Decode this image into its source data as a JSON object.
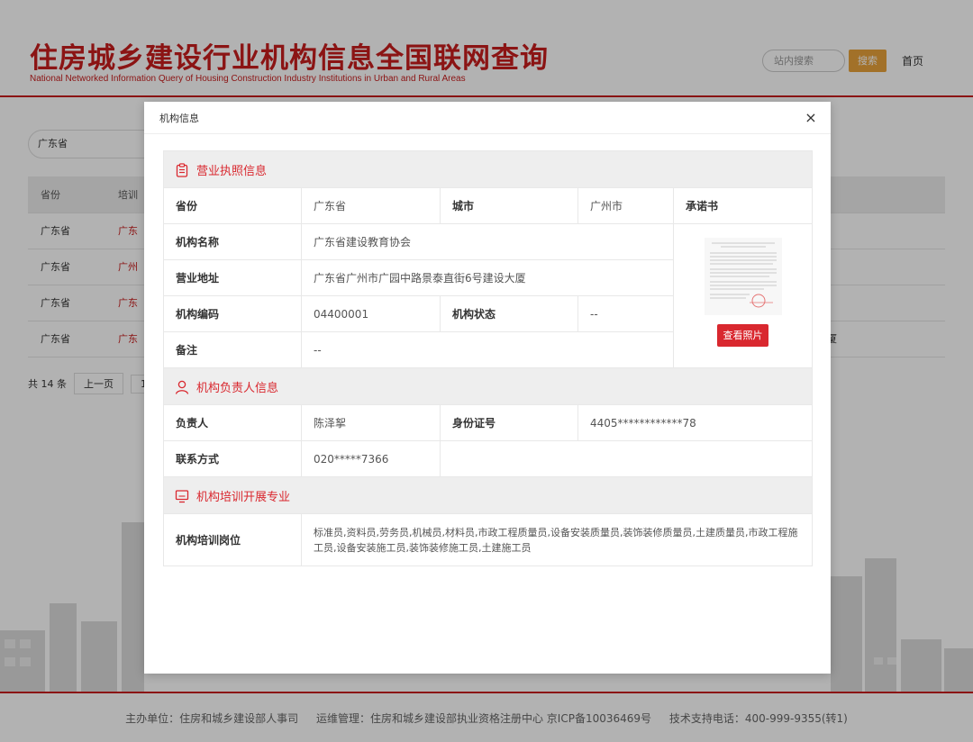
{
  "site": {
    "title": "住房城乡建设行业机构信息全国联网查询",
    "subtitle": "National Networked Information Query of Housing Construction Industry Institutions in Urban and Rural Areas",
    "search_placeholder": "站内搜索",
    "search_button": "搜索",
    "home_link": "首页"
  },
  "filter": {
    "province": "广东省"
  },
  "list": {
    "headers": [
      "省份",
      "培训"
    ],
    "rows": [
      {
        "province": "广东省",
        "org": "广东",
        "extra": ""
      },
      {
        "province": "广东省",
        "org": "广州",
        "extra": ""
      },
      {
        "province": "广东省",
        "org": "广东",
        "extra": ""
      },
      {
        "province": "广东省",
        "org": "广东",
        "extra": "厦"
      }
    ],
    "total": "共 14 条",
    "prev": "上一页",
    "page": "1"
  },
  "footer": {
    "host": "主办单位：住房和城乡建设部人事司",
    "ops": "运维管理：住房和城乡建设部执业资格注册中心 京ICP备10036469号",
    "support": "技术支持电话：400-999-9355(转1)"
  },
  "modal": {
    "title": "机构信息",
    "close": "×",
    "license_section": "营业执照信息",
    "province_label": "省份",
    "province_value": "广东省",
    "city_label": "城市",
    "city_value": "广州市",
    "commitment_label": "承诺书",
    "org_name_label": "机构名称",
    "org_name_value": "广东省建设教育协会",
    "address_label": "营业地址",
    "address_value": "广东省广州市广园中路景泰直街6号建设大厦",
    "code_label": "机构编码",
    "code_value": "04400001",
    "status_label": "机构状态",
    "status_value": "--",
    "remark_label": "备注",
    "remark_value": "--",
    "view_photo": "查看照片",
    "head_section": "机构负责人信息",
    "head_label": "负责人",
    "head_value": "陈泽挐",
    "id_label": "身份证号",
    "id_value": "4405************78",
    "contact_label": "联系方式",
    "contact_value": "020*****7366",
    "training_section": "机构培训开展专业",
    "training_label": "机构培训岗位",
    "training_value": "标准员,资料员,劳务员,机械员,材料员,市政工程质量员,设备安装质量员,装饰装修质量员,土建质量员,市政工程施工员,设备安装施工员,装饰装修施工员,土建施工员"
  },
  "colors": {
    "brand_red": "#c81e1e",
    "accent_red": "#d9282f",
    "search_orange": "#e8a33c"
  }
}
